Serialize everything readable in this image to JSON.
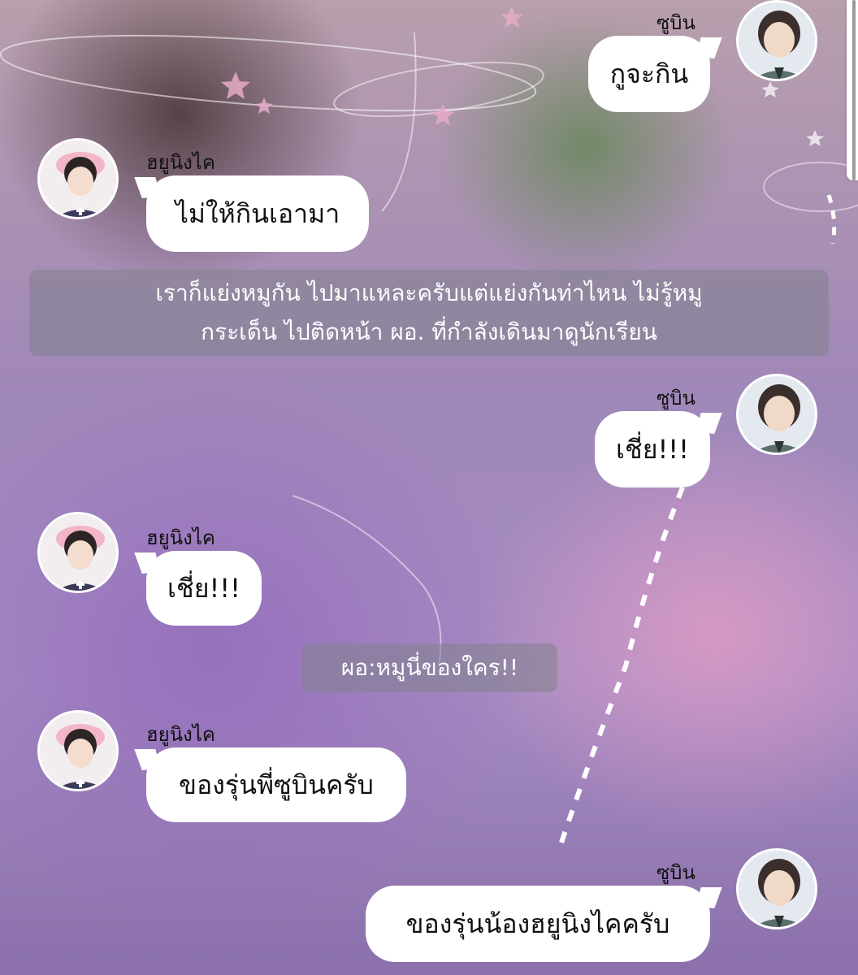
{
  "characters": {
    "right": "ซูบิน",
    "left": "ฮยูนิงไค"
  },
  "messages": [
    {
      "speaker": "ซูบิน",
      "text": "กูจะกิน"
    },
    {
      "speaker": "ฮยูนิงไค",
      "text": "ไม่ให้กินเอามา"
    },
    {
      "speaker": "ซูบิน",
      "text": "เชี่ย!!!"
    },
    {
      "speaker": "ฮยูนิงไค",
      "text": "เชี่ย!!!"
    },
    {
      "speaker": "ฮยูนิงไค",
      "text": "ของรุ่นพี่ซูบินครับ"
    },
    {
      "speaker": "ซูบิน",
      "text": "ของรุ่นน้องฮยูนิงไคครับ"
    }
  ],
  "narration": {
    "line1": "เราก็แย่งหมูกัน ไปมาแหละครับแต่แย่งกันท่าไหน ไม่รู้หมู",
    "line2": "กระเด็น ไปติดหน้า ผอ. ที่กำลังเดินมาดูนักเรียน",
    "dialogue": "ผอ:หมูนี่ของใคร!!"
  },
  "colors": {
    "bubble": "#ffffff",
    "narration_bg": "#82828c"
  },
  "icons": [
    "avatar-soobin",
    "avatar-hueningkai",
    "star-decoration",
    "orbit-decoration"
  ]
}
